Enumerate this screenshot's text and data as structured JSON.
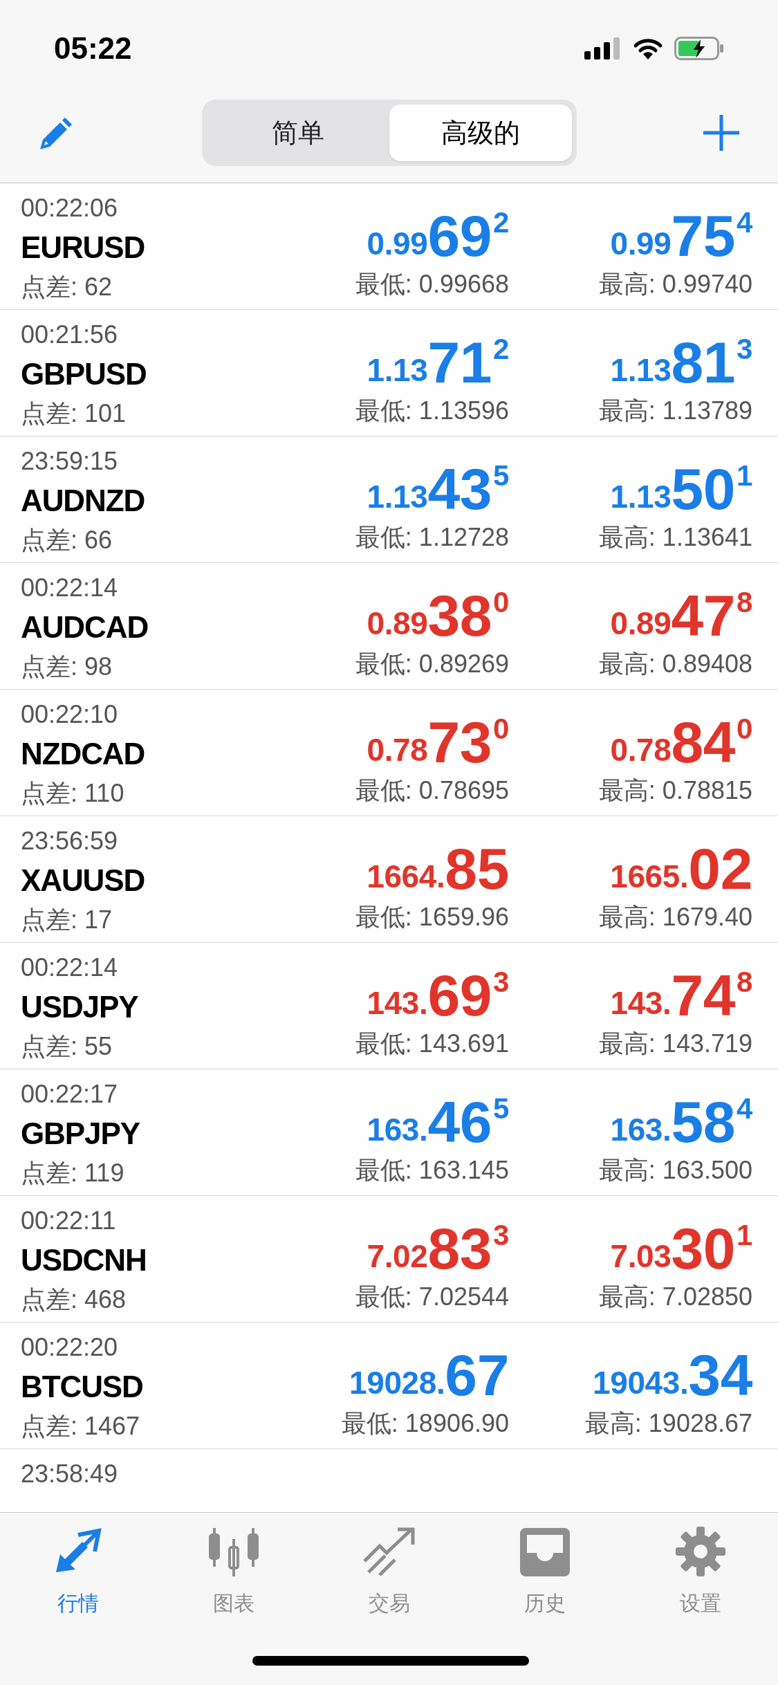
{
  "status_bar": {
    "time": "05:22"
  },
  "segments": [
    {
      "label": "简单",
      "selected": false
    },
    {
      "label": "高级的",
      "selected": true
    }
  ],
  "quotes": [
    {
      "time": "00:22:06",
      "symbol": "EURUSD",
      "spread": "点差: 62",
      "color": "#1a7ee6",
      "bid": {
        "prefix": "0.99",
        "big": "69",
        "sup": "2"
      },
      "ask": {
        "prefix": "0.99",
        "big": "75",
        "sup": "4"
      },
      "low": "最低: 0.99668",
      "high": "最高: 0.99740"
    },
    {
      "time": "00:21:56",
      "symbol": "GBPUSD",
      "spread": "点差: 101",
      "color": "#1a7ee6",
      "bid": {
        "prefix": "1.13",
        "big": "71",
        "sup": "2"
      },
      "ask": {
        "prefix": "1.13",
        "big": "81",
        "sup": "3"
      },
      "low": "最低: 1.13596",
      "high": "最高: 1.13789"
    },
    {
      "time": "23:59:15",
      "symbol": "AUDNZD",
      "spread": "点差: 66",
      "color": "#1a7ee6",
      "bid": {
        "prefix": "1.13",
        "big": "43",
        "sup": "5"
      },
      "ask": {
        "prefix": "1.13",
        "big": "50",
        "sup": "1"
      },
      "low": "最低: 1.12728",
      "high": "最高: 1.13641"
    },
    {
      "time": "00:22:14",
      "symbol": "AUDCAD",
      "spread": "点差: 98",
      "color": "#e0352b",
      "bid": {
        "prefix": "0.89",
        "big": "38",
        "sup": "0"
      },
      "ask": {
        "prefix": "0.89",
        "big": "47",
        "sup": "8"
      },
      "low": "最低: 0.89269",
      "high": "最高: 0.89408"
    },
    {
      "time": "00:22:10",
      "symbol": "NZDCAD",
      "spread": "点差: 110",
      "color": "#e0352b",
      "bid": {
        "prefix": "0.78",
        "big": "73",
        "sup": "0"
      },
      "ask": {
        "prefix": "0.78",
        "big": "84",
        "sup": "0"
      },
      "low": "最低: 0.78695",
      "high": "最高: 0.78815"
    },
    {
      "time": "23:56:59",
      "symbol": "XAUUSD",
      "spread": "点差: 17",
      "color": "#e0352b",
      "bid": {
        "prefix": "1664.",
        "big": "85"
      },
      "ask": {
        "prefix": "1665.",
        "big": "02"
      },
      "low": "最低: 1659.96",
      "high": "最高: 1679.40"
    },
    {
      "time": "00:22:14",
      "symbol": "USDJPY",
      "spread": "点差: 55",
      "color": "#e0352b",
      "bid": {
        "prefix": "143.",
        "big": "69",
        "sup": "3"
      },
      "ask": {
        "prefix": "143.",
        "big": "74",
        "sup": "8"
      },
      "low": "最低: 143.691",
      "high": "最高: 143.719"
    },
    {
      "time": "00:22:17",
      "symbol": "GBPJPY",
      "spread": "点差: 119",
      "color": "#1a7ee6",
      "bid": {
        "prefix": "163.",
        "big": "46",
        "sup": "5"
      },
      "ask": {
        "prefix": "163.",
        "big": "58",
        "sup": "4"
      },
      "low": "最低: 163.145",
      "high": "最高: 163.500"
    },
    {
      "time": "00:22:11",
      "symbol": "USDCNH",
      "spread": "点差: 468",
      "color": "#e0352b",
      "bid": {
        "prefix": "7.02",
        "big": "83",
        "sup": "3"
      },
      "ask": {
        "prefix": "7.03",
        "big": "30",
        "sup": "1"
      },
      "low": "最低: 7.02544",
      "high": "最高: 7.02850"
    },
    {
      "time": "00:22:20",
      "symbol": "BTCUSD",
      "spread": "点差: 1467",
      "color": "#1a7ee6",
      "bid": {
        "prefix": "19028.",
        "big": "67"
      },
      "ask": {
        "prefix": "19043.",
        "big": "34"
      },
      "low": "最低: 18906.90",
      "high": "最高: 19028.67"
    },
    {
      "time": "23:58:49"
    }
  ],
  "tab_bar": [
    {
      "label": "行情",
      "kind": "quotes",
      "selected": true
    },
    {
      "label": "图表",
      "kind": "charts",
      "selected": false
    },
    {
      "label": "交易",
      "kind": "trade",
      "selected": false
    },
    {
      "label": "历史",
      "kind": "history",
      "selected": false
    },
    {
      "label": "设置",
      "kind": "settings",
      "selected": false
    }
  ]
}
